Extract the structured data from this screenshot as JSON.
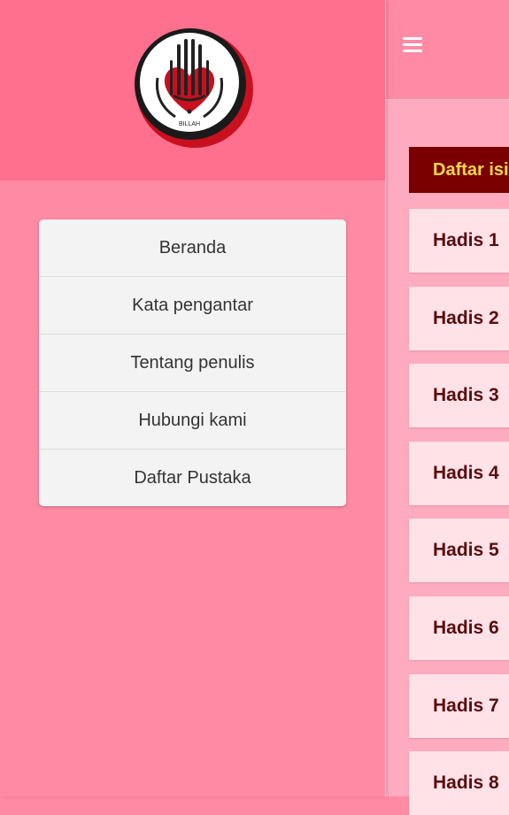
{
  "app": {
    "accent_color": "#ff8aa6",
    "menu_icon": "hamburger-menu-icon"
  },
  "drawer": {
    "logo": {
      "icon": "billah-logo-icon",
      "text": "BILLAH"
    },
    "menu_items": [
      {
        "label": "Beranda"
      },
      {
        "label": "Kata pengantar"
      },
      {
        "label": "Tentang penulis"
      },
      {
        "label": "Hubungi kami"
      },
      {
        "label": "Daftar Pustaka"
      }
    ]
  },
  "content": {
    "header_label": "Daftar isi",
    "header_color": "#7a0000",
    "items": [
      {
        "label": "Hadis 1"
      },
      {
        "label": "Hadis 2"
      },
      {
        "label": "Hadis 3"
      },
      {
        "label": "Hadis 4"
      },
      {
        "label": "Hadis 5"
      },
      {
        "label": "Hadis 6"
      },
      {
        "label": "Hadis 7"
      },
      {
        "label": "Hadis 8"
      }
    ]
  }
}
